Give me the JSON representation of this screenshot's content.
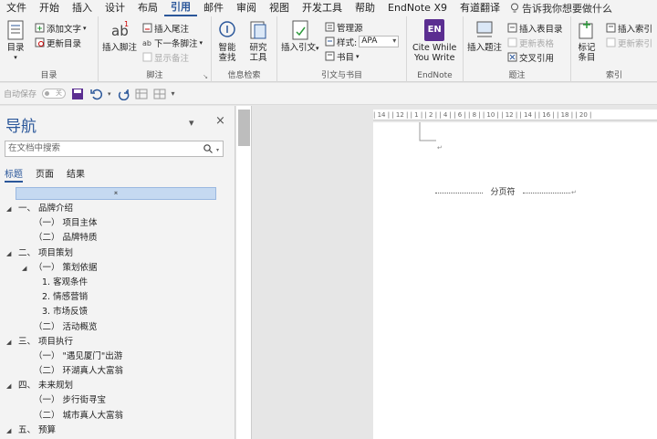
{
  "tabs": [
    "文件",
    "开始",
    "插入",
    "设计",
    "布局",
    "引用",
    "邮件",
    "审阅",
    "视图",
    "开发工具",
    "帮助",
    "EndNote X9",
    "有道翻译"
  ],
  "active_tab": "引用",
  "tellme": "告诉我你想要做什么",
  "ribbon": {
    "toc": {
      "label": "目录",
      "toc_btn": "目录",
      "add_text": "添加文字",
      "update_toc": "更新目录"
    },
    "footnotes": {
      "label": "脚注",
      "insert_footnote": "插入脚注",
      "insert_endnote": "插入尾注",
      "next_footnote": "下一条脚注",
      "show_notes": "显示备注"
    },
    "research": {
      "label": "信息检索",
      "smart_lookup_1": "智能",
      "smart_lookup_2": "查找",
      "researcher_1": "研究",
      "researcher_2": "工具"
    },
    "citations": {
      "label": "引文与书目",
      "insert_citation": "插入引文",
      "manage_sources": "管理源",
      "style_label": "样式:",
      "style_value": "APA",
      "bibliography": "书目"
    },
    "endnote": {
      "label": "EndNote",
      "logo": "EN",
      "cite_1": "Cite While",
      "cite_2": "You Write"
    },
    "captions": {
      "label": "题注",
      "insert_caption": "插入题注",
      "insert_tof": "插入表目录",
      "update_table": "更新表格",
      "cross_ref": "交叉引用"
    },
    "index": {
      "label": "索引",
      "mark_entry_1": "标记",
      "mark_entry_2": "条目",
      "insert_index": "插入索引",
      "update_index": "更新索引"
    }
  },
  "qat": {
    "autosave": "自动保存",
    "toggle": "关"
  },
  "nav": {
    "title": "导航",
    "search_placeholder": "在文档中搜索",
    "tabs": [
      "标题",
      "页面",
      "结果"
    ],
    "outline": [
      {
        "text": "一、 品牌介绍",
        "level": 1,
        "expanded": true
      },
      {
        "text": "（一） 项目主体",
        "level": 2
      },
      {
        "text": "（二） 品牌特质",
        "level": 2
      },
      {
        "text": "二、 项目策划",
        "level": 1,
        "expanded": true
      },
      {
        "text": "（一） 策划依据",
        "level": 2,
        "expanded": true
      },
      {
        "text": "1. 客观条件",
        "level": 3
      },
      {
        "text": "2. 情感营销",
        "level": 3
      },
      {
        "text": "3. 市场反馈",
        "level": 3
      },
      {
        "text": "（二） 活动概览",
        "level": 2
      },
      {
        "text": "三、 项目执行",
        "level": 1,
        "expanded": true
      },
      {
        "text": "（一） \"遇见厦门\"出游",
        "level": 2
      },
      {
        "text": "（二） 环湖真人大富翁",
        "level": 2
      },
      {
        "text": "四、 未来规划",
        "level": 1,
        "expanded": true
      },
      {
        "text": "（一） 步行街寻宝",
        "level": 2
      },
      {
        "text": "（二） 城市真人大富翁",
        "level": 2
      },
      {
        "text": "五、 预算",
        "level": 1,
        "expanded": true
      }
    ]
  },
  "doc": {
    "page_break": "分页符",
    "ruler_h": "| 14 |  | 12 |  | 1 |     | 2 |  | 4 |  | 6 |  | 8 |  | 10 |  | 12 |  | 14 |  | 16 |  | 18 |  | 20 |"
  }
}
